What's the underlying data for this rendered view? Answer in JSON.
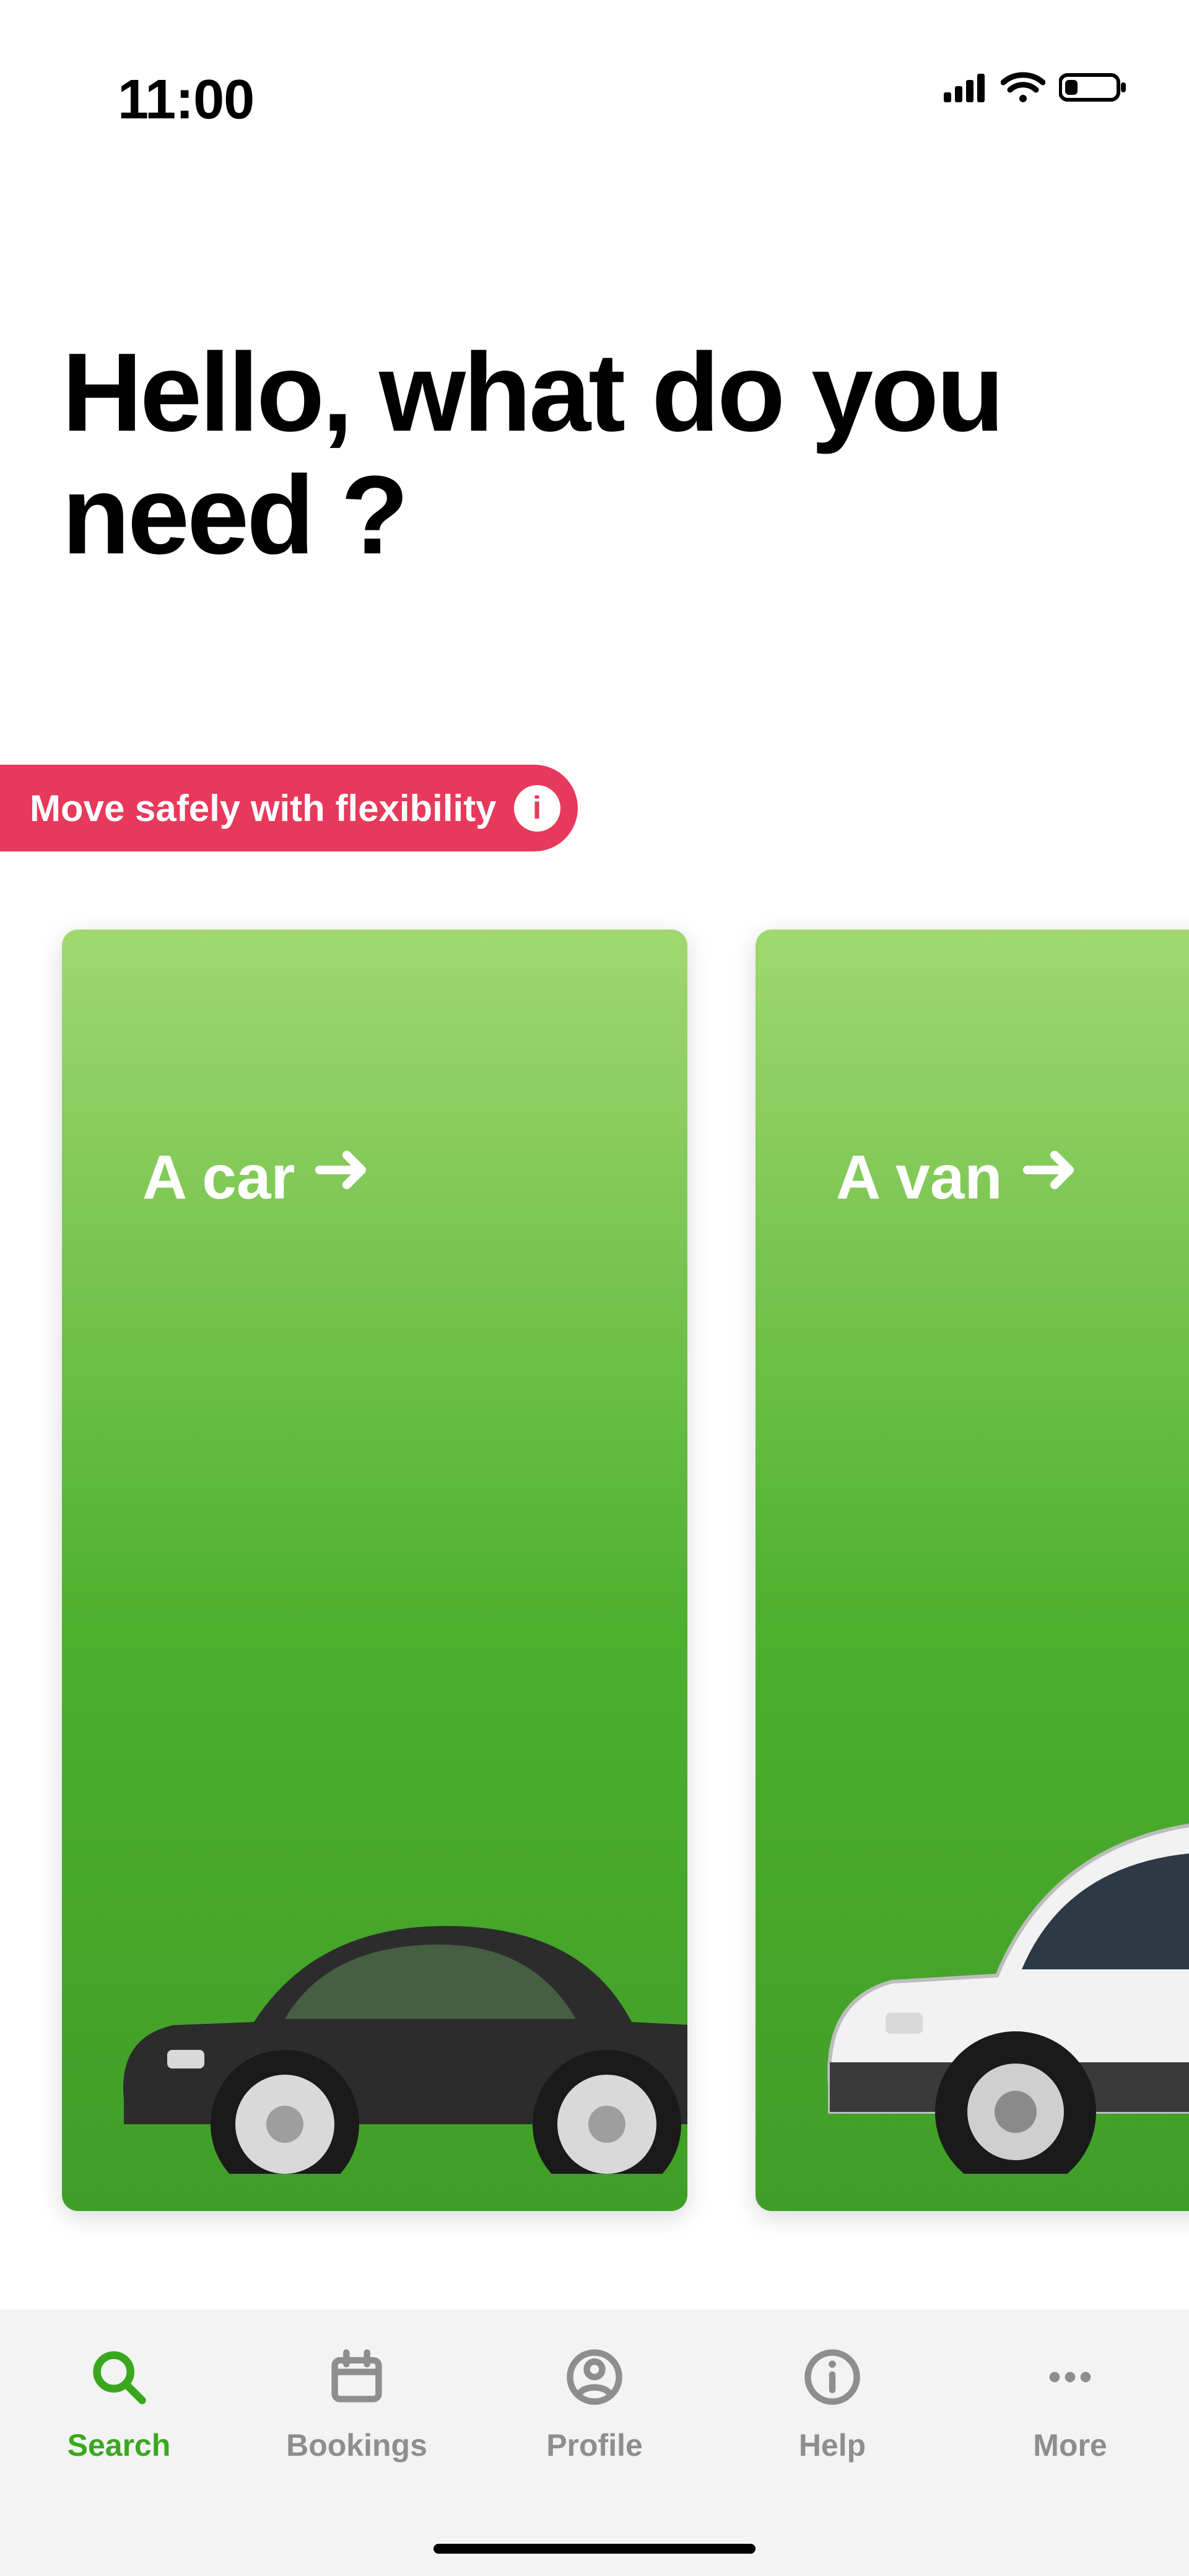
{
  "status": {
    "time": "11:00"
  },
  "headline": "Hello, what do you need ?",
  "promo": {
    "text": "Move safely with flexibility",
    "badge": "i"
  },
  "cards": [
    {
      "label": "A car"
    },
    {
      "label": "A van"
    }
  ],
  "tabs": [
    {
      "label": "Search",
      "active": true
    },
    {
      "label": "Bookings",
      "active": false
    },
    {
      "label": "Profile",
      "active": false
    },
    {
      "label": "Help",
      "active": false
    },
    {
      "label": "More",
      "active": false
    }
  ]
}
